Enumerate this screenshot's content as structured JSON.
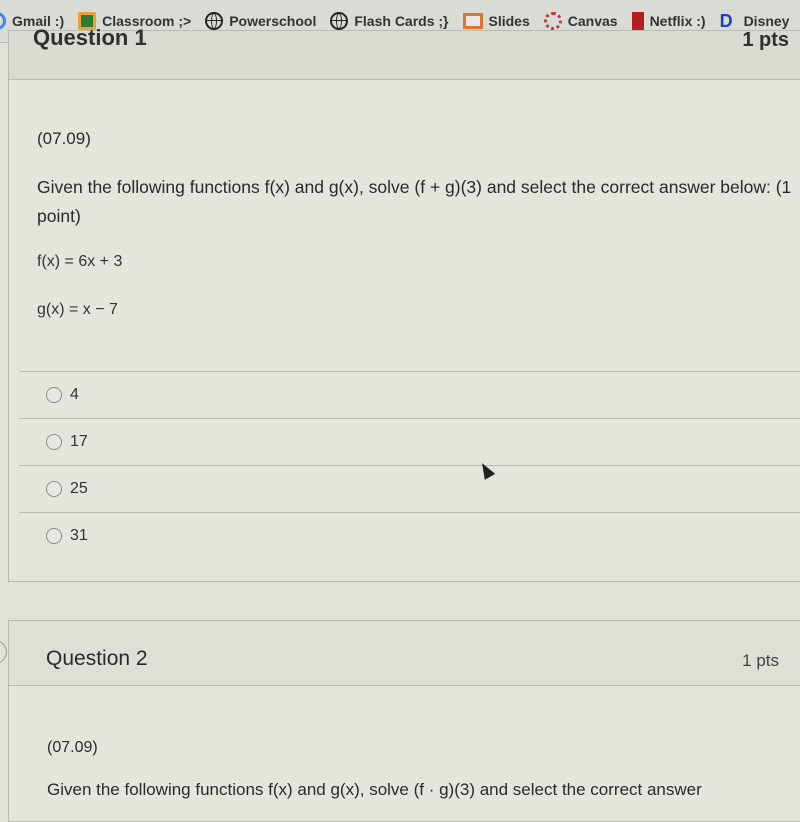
{
  "bookmarks": [
    {
      "label": "Gmail :)",
      "icon": "google-icon"
    },
    {
      "label": "Classroom ;>",
      "icon": "classroom-icon"
    },
    {
      "label": "Powerschool",
      "icon": "globe-icon"
    },
    {
      "label": "Flash Cards ;}",
      "icon": "globe-icon"
    },
    {
      "label": "Slides",
      "icon": "slides-icon"
    },
    {
      "label": "Canvas",
      "icon": "canvas-icon"
    },
    {
      "label": "Netflix :)",
      "icon": "netflix-icon"
    },
    {
      "label": "Disney",
      "icon": "disney-icon"
    }
  ],
  "question1": {
    "title": "Question 1",
    "points": "1 pts",
    "code": "(07.09)",
    "prompt": "Given the following functions f(x) and g(x), solve (f + g)(3) and select the correct answer below: (1 point)",
    "equations": [
      "f(x) = 6x + 3",
      "g(x) = x − 7"
    ],
    "answers": [
      "4",
      "17",
      "25",
      "31"
    ]
  },
  "question2": {
    "title": "Question 2",
    "points": "1 pts",
    "code": "(07.09)",
    "prompt": "Given the following functions f(x) and g(x), solve (f · g)(3) and select the correct answer"
  }
}
